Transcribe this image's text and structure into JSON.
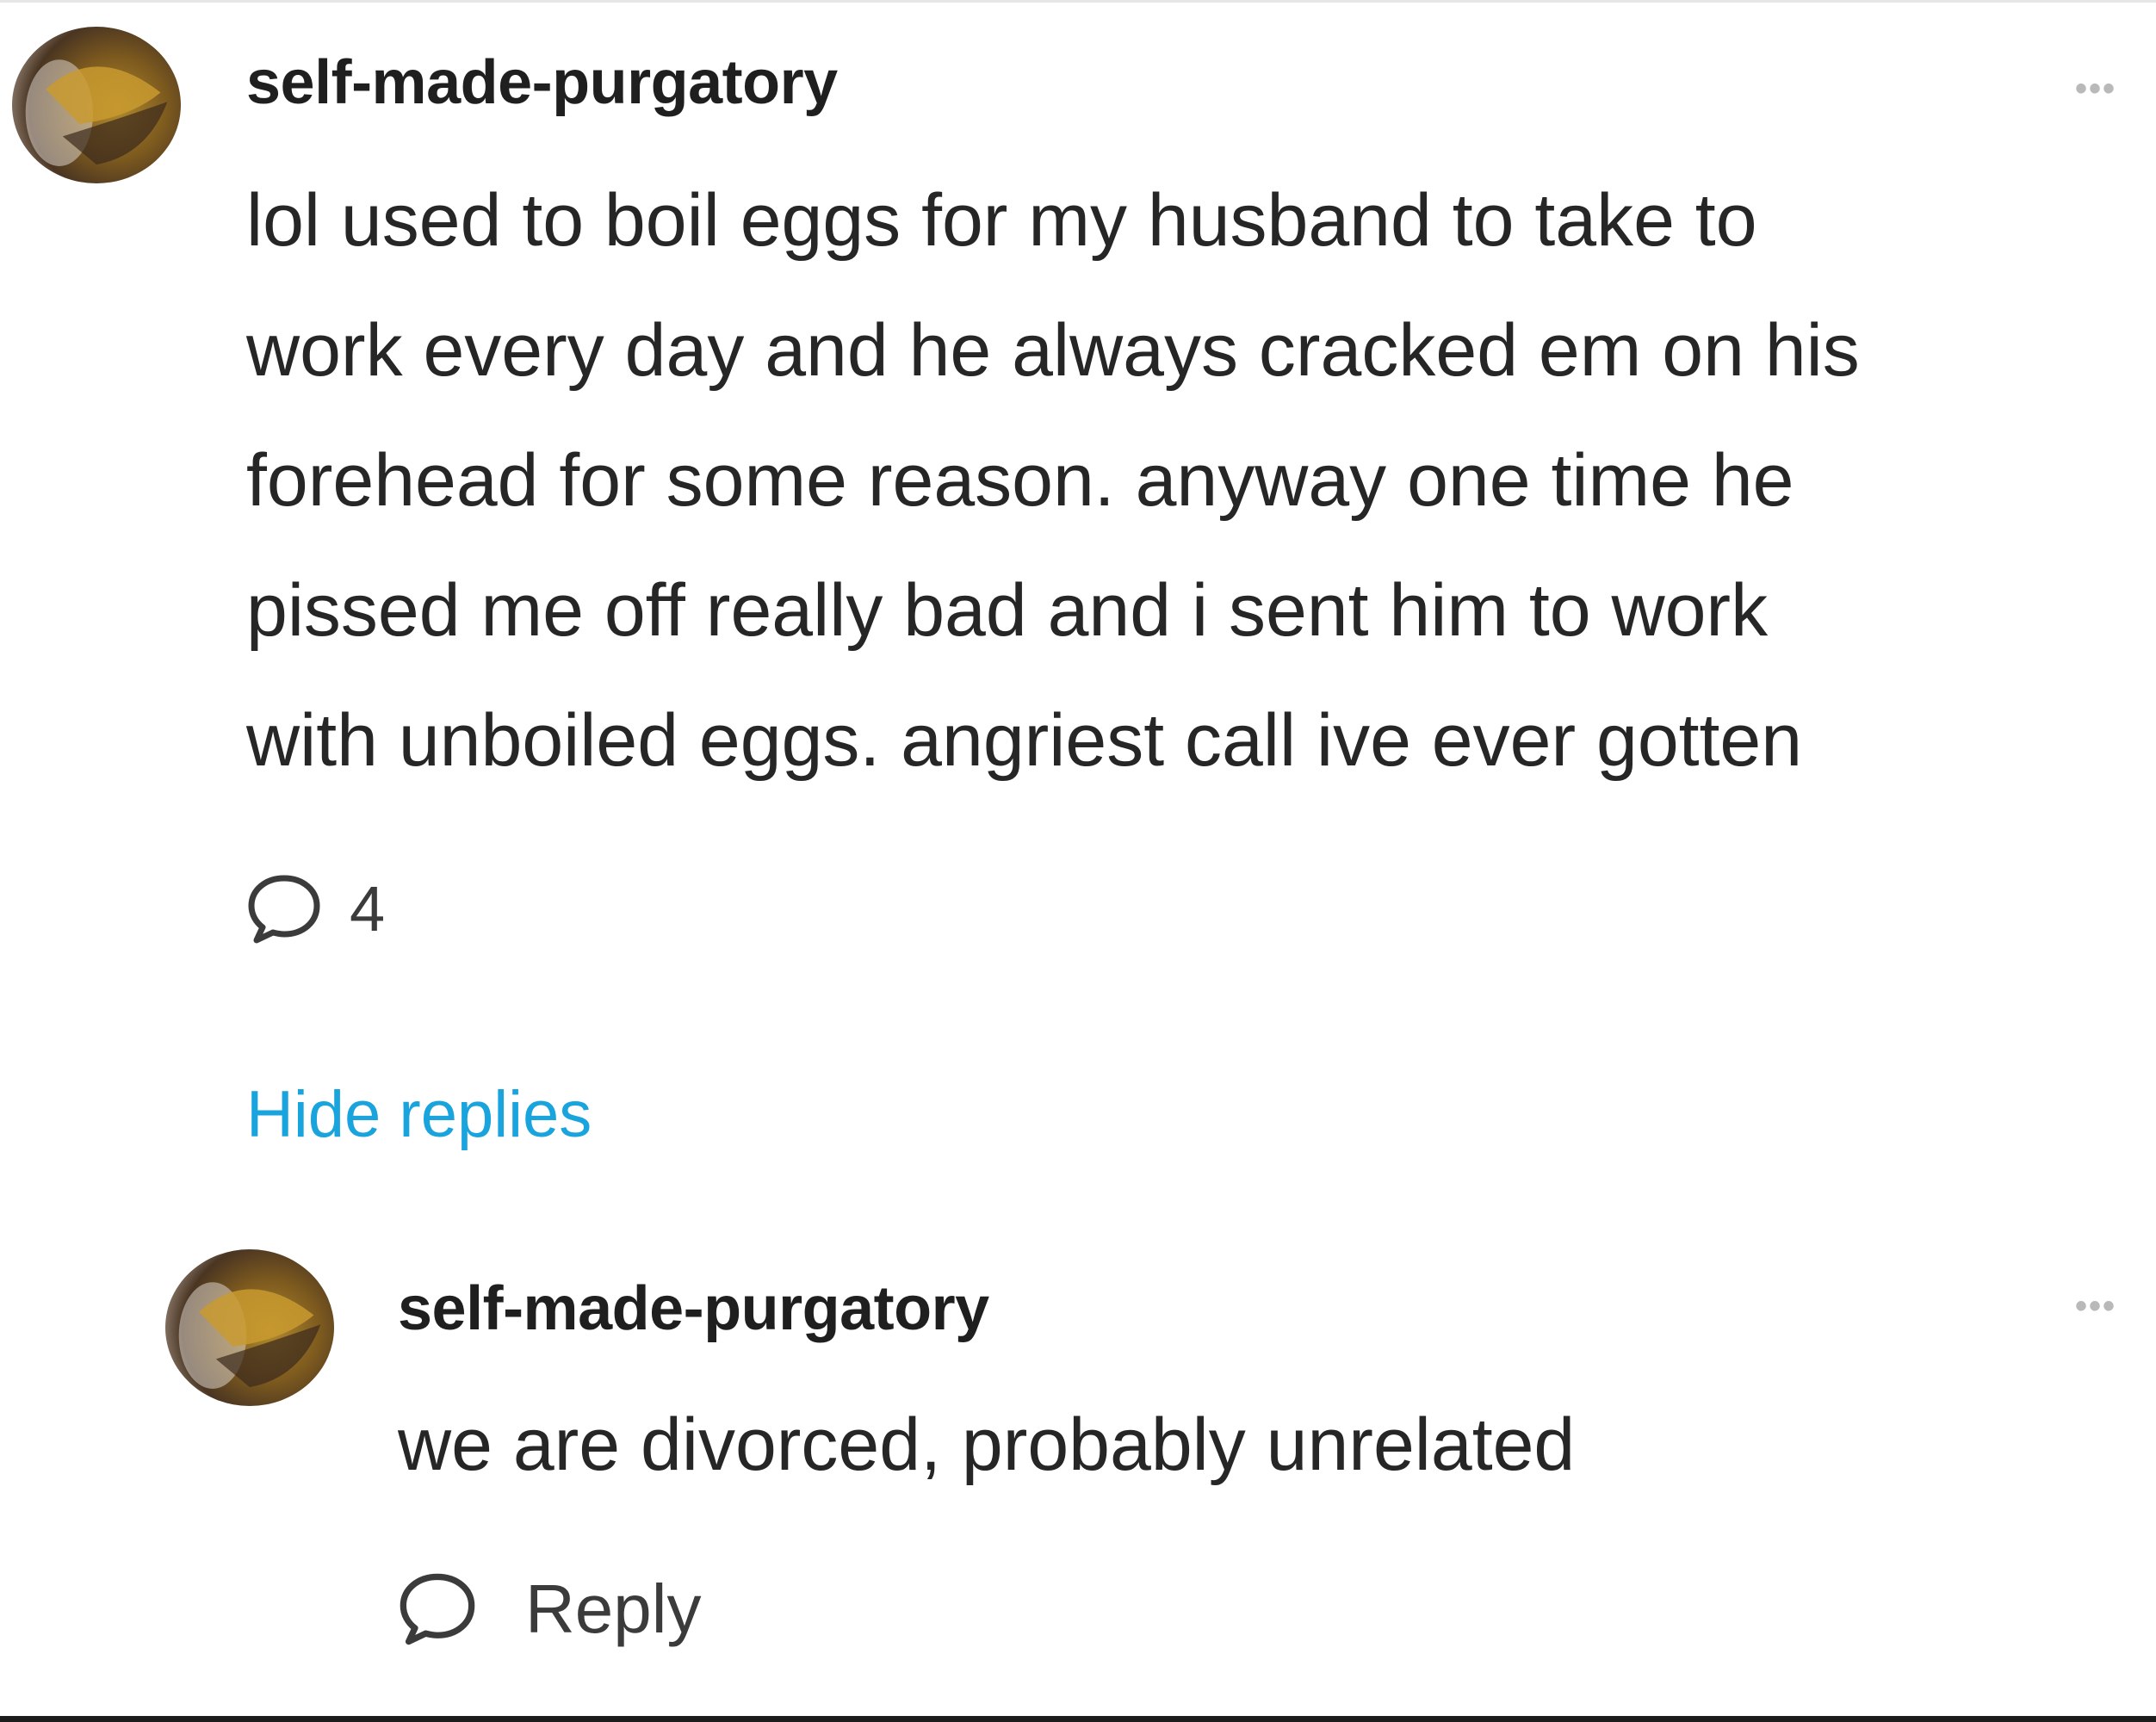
{
  "comment": {
    "username": "self-made-purgatory",
    "more_label": "•••",
    "text_lines": [
      "lol used to boil eggs for my husband to take to",
      "work every day and he always cracked em on his",
      "forehead for some reason. anyway one time he",
      "pissed me off really bad and i sent him to work",
      "with unboiled eggs. angriest call ive ever gotten"
    ],
    "reply_count": "4",
    "reply_icon": "speech-bubble-icon"
  },
  "hide_replies_label": "Hide replies",
  "reply": {
    "username": "self-made-purgatory",
    "more_label": "•••",
    "text": "we are divorced, probably unrelated",
    "reply_label": "Reply",
    "reply_icon": "speech-bubble-icon"
  },
  "colors": {
    "link": "#1aa4dd",
    "text": "#262626",
    "muted": "#b9b9b9"
  }
}
